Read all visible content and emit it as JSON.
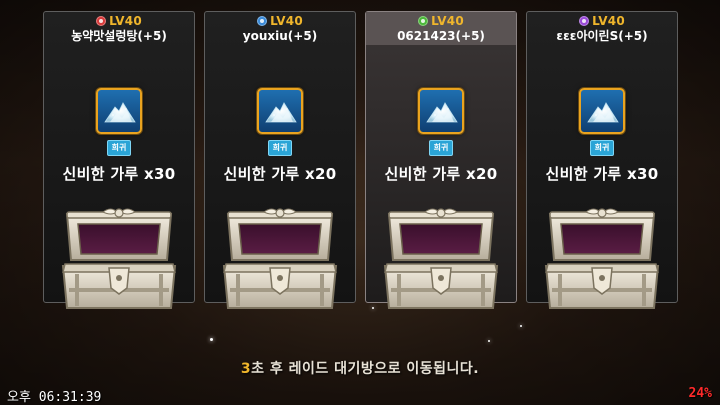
{
  "players": [
    {
      "level": "LV40",
      "name": "농약맛설렁탕(+5)",
      "class_icon": "red-x-class-icon",
      "class_color": "#d83a3a",
      "highlighted": false,
      "rarity": "희귀",
      "item_name": "신비한 가루 x30"
    },
    {
      "level": "LV40",
      "name": "youxiu(+5)",
      "class_icon": "blue-class-icon",
      "class_color": "#3a8ad8",
      "highlighted": false,
      "rarity": "희귀",
      "item_name": "신비한 가루 x20"
    },
    {
      "level": "LV40",
      "name": "0621423(+5)",
      "class_icon": "green-plus-class-icon",
      "class_color": "#4cb83a",
      "highlighted": true,
      "rarity": "희귀",
      "item_name": "신비한 가루 x20"
    },
    {
      "level": "LV40",
      "name": "εεε아이린S(+5)",
      "class_icon": "purple-x-class-icon",
      "class_color": "#9a4ad8",
      "highlighted": false,
      "rarity": "희귀",
      "item_name": "신비한 가루 x30"
    }
  ],
  "status": {
    "countdown": "3",
    "message": "초 후 레이드 대기방으로 이동됩니다."
  },
  "system": {
    "clock": "오후 06:31:39",
    "battery": "24%"
  },
  "colors": {
    "level_text": "#f0b62c",
    "rarity_badge": "#2aa4d6",
    "battery_low": "#ff2a2a",
    "item_frame": "#e9a320"
  },
  "icons": {
    "item": "mystic-powder-icon",
    "chest": "open-treasure-chest-icon"
  }
}
